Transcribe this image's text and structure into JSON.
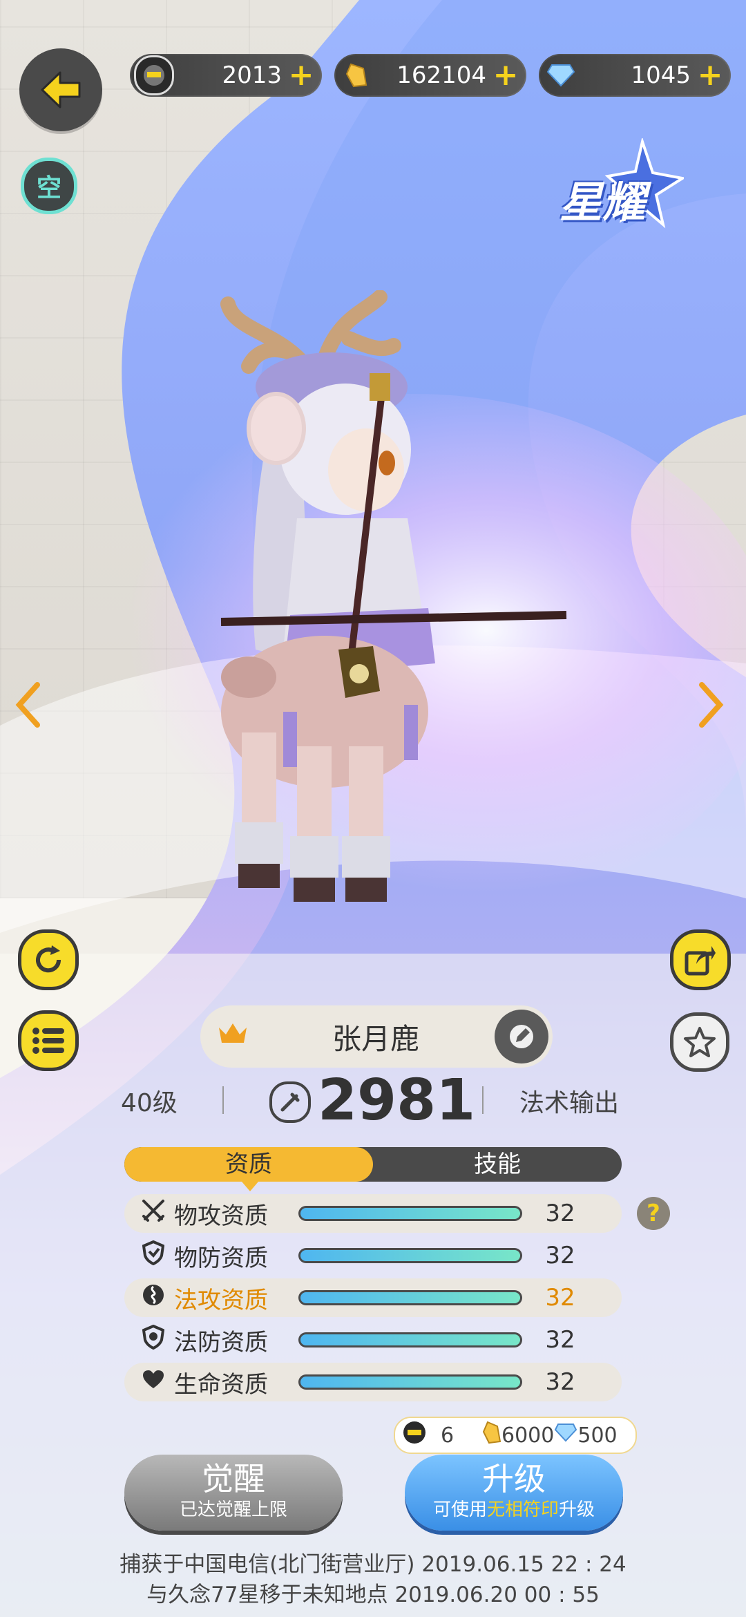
{
  "header": {
    "currencies": [
      {
        "icon": "token-icon",
        "value": "2013",
        "plus": "+"
      },
      {
        "icon": "crystal-icon",
        "value": "162104",
        "plus": "+"
      },
      {
        "icon": "diamond-icon",
        "value": "1045",
        "plus": "+"
      }
    ],
    "kong_label": "空",
    "badge": "星耀"
  },
  "pet": {
    "name": "张月鹿",
    "level": "40级",
    "power": "2981",
    "role": "法术输出"
  },
  "tabs": [
    {
      "label": "资质",
      "active": true
    },
    {
      "label": "技能",
      "active": false
    }
  ],
  "attributes": [
    {
      "icon": "sword-icon",
      "label": "物攻资质",
      "value": "32",
      "fill": 1.0,
      "highlight": false
    },
    {
      "icon": "shield-icon",
      "label": "物防资质",
      "value": "32",
      "fill": 1.0,
      "highlight": false
    },
    {
      "icon": "magic-swirl-icon",
      "label": "法攻资质",
      "value": "32",
      "fill": 1.0,
      "highlight": true
    },
    {
      "icon": "magic-shield-icon",
      "label": "法防资质",
      "value": "32",
      "fill": 1.0,
      "highlight": false
    },
    {
      "icon": "heart-icon",
      "label": "生命资质",
      "value": "32",
      "fill": 1.0,
      "highlight": false
    }
  ],
  "help_label": "?",
  "cost": {
    "token": "6",
    "crystal": "6000",
    "diamond": "500"
  },
  "buttons": {
    "awaken_main": "觉醒",
    "awaken_sub": "已达觉醒上限",
    "upgrade_main": "升级",
    "upgrade_sub_pre": "可使用",
    "upgrade_sub_em": "无相符印",
    "upgrade_sub_post": "升级"
  },
  "footer": {
    "line1": "捕获于中国电信(北门街营业厅) 2019.06.15   22 : 24",
    "line2": "与久念77星移于未知地点 2019.06.20   00 : 55"
  },
  "colors": {
    "accent_yellow": "#f5d21d",
    "tab_active": "#f5b932",
    "highlight_orange": "#e08a00",
    "upgrade_blue": "#3a8fe6"
  }
}
